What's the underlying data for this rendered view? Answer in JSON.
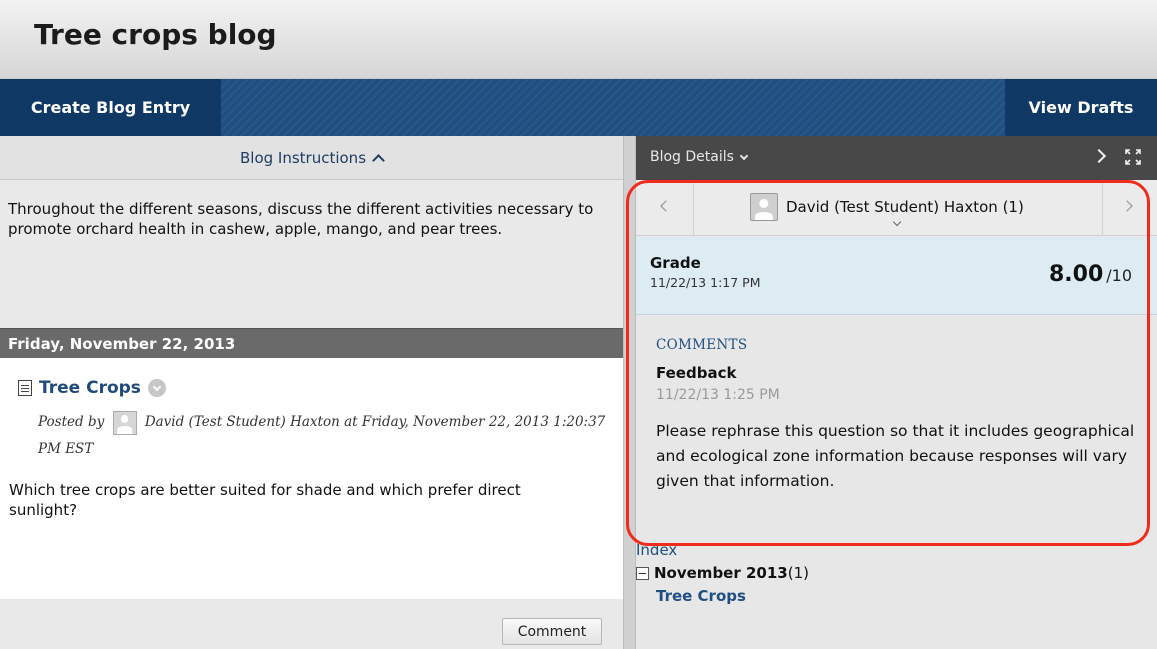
{
  "page": {
    "title": "Tree crops blog"
  },
  "toolbar": {
    "create_label": "Create Blog Entry",
    "drafts_label": "View Drafts"
  },
  "instructions": {
    "header": "Blog Instructions",
    "text": "Throughout the different seasons, discuss the different activities necessary to promote orchard health in cashew, apple, mango, and pear trees."
  },
  "entry": {
    "date_header": "Friday, November 22, 2013",
    "title": "Tree Crops",
    "posted_by_prefix": "Posted by",
    "author": "David (Test Student) Haxton",
    "posted_at": "at Friday, November 22, 2013 1:20:37 PM EST",
    "body": "Which tree crops are better suited for shade and which prefer direct sunlight?",
    "comment_label": "Comment"
  },
  "details": {
    "header": "Blog Details",
    "student_name": "David (Test Student) Haxton (1)",
    "grade": {
      "label": "Grade",
      "date": "11/22/13 1:17 PM",
      "value": "8.00",
      "max": "/10"
    },
    "comments": {
      "heading": "COMMENTS",
      "feedback_title": "Feedback",
      "feedback_date": "11/22/13 1:25 PM",
      "feedback_text": "Please rephrase this question so that it includes geographical and ecological zone information because responses will vary given that information."
    },
    "index": {
      "label": "Index",
      "month": "November 2013",
      "month_count": "(1)",
      "post": "Tree Crops"
    }
  },
  "colors": {
    "action_bar": "#1f4f80",
    "action_button": "#0f3864",
    "grade_panel": "#dcecf2",
    "highlight": "#ef2b1c"
  }
}
